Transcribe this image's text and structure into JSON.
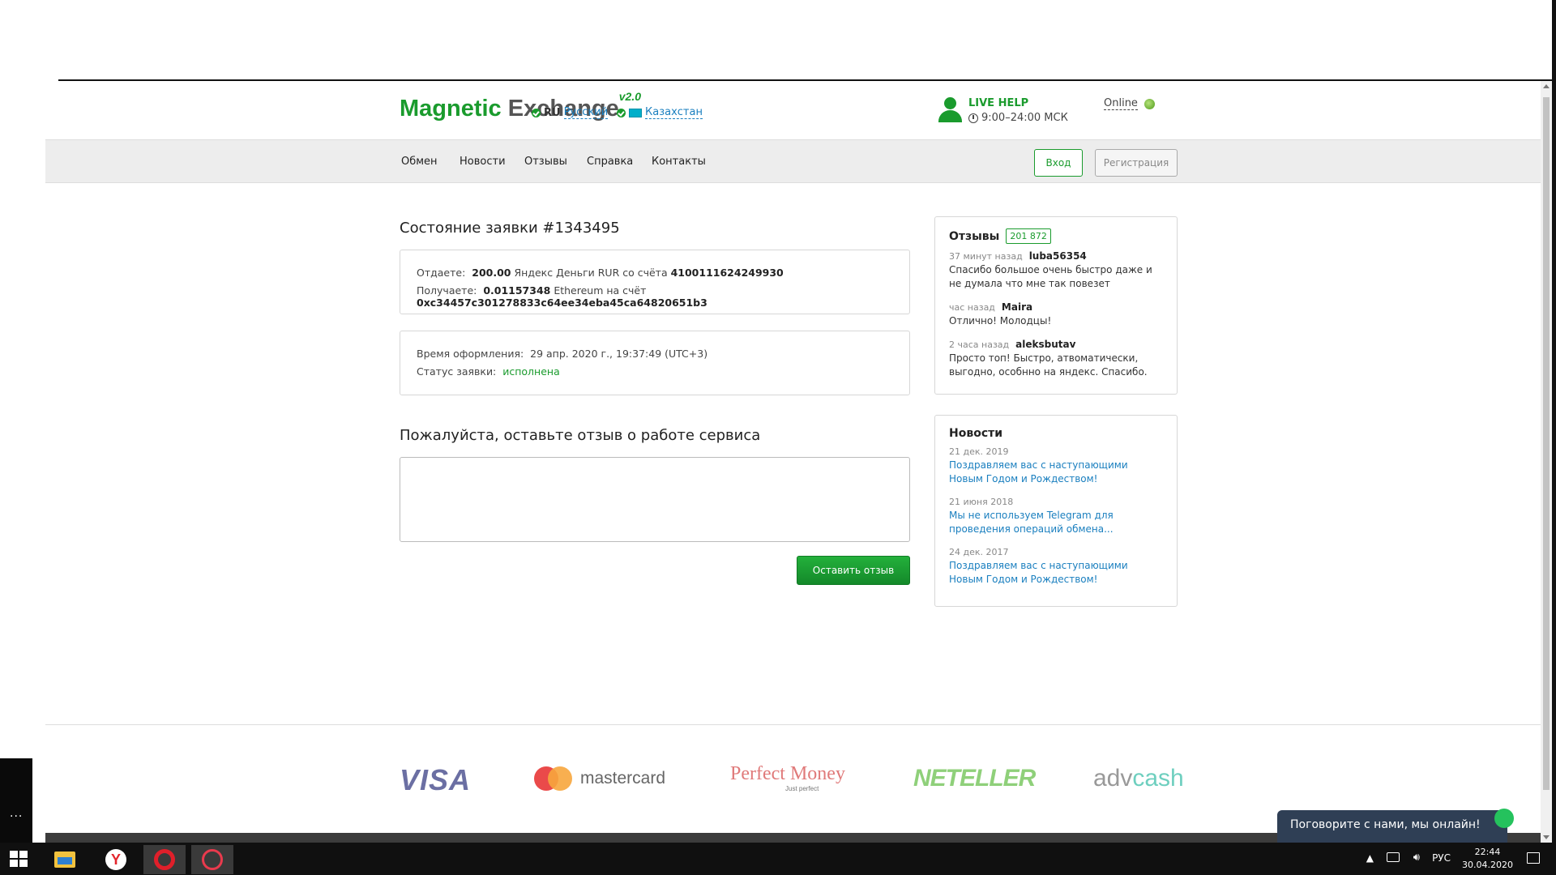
{
  "header": {
    "logo_part1": "Magnetic",
    "logo_part2": "Exchange",
    "logo_version": "v2.0",
    "lang_code": "RU",
    "lang_name": "Русский",
    "country": "Казахстан",
    "live_help": "LIVE HELP",
    "live_help_hours": "9:00–24:00 МСК",
    "online": "Online"
  },
  "nav": {
    "items": [
      "Обмен",
      "Новости",
      "Отзывы",
      "Справка",
      "Контакты"
    ],
    "login": "Вход",
    "register": "Регистрация"
  },
  "order": {
    "title": "Состояние заявки #1343495",
    "give_label": "Отдаете:",
    "give_amount": "200.00",
    "give_currency": "Яндекс Деньги RUR со счёта",
    "give_account": "4100111624249930",
    "get_label": "Получаете:",
    "get_amount": "0.01157348",
    "get_currency": "Ethereum на счёт",
    "get_account": "0xc34457c301278833c64ee34eba45ca64820651b3",
    "time_label": "Время оформления:",
    "time_value": "29 апр. 2020 г., 19:37:49 (UTC+3)",
    "status_label": "Статус заявки:",
    "status_value": "исполнена"
  },
  "feedback": {
    "title": "Пожалуйста, оставьте отзыв о работе сервиса",
    "textarea_value": "",
    "submit": "Оставить отзыв"
  },
  "reviews": {
    "title": "Отзывы",
    "count": "201 872",
    "items": [
      {
        "time": "37 минут назад",
        "user": "luba56354",
        "text": "Спасибо большое очень быстро даже и не думала что мне так повезет"
      },
      {
        "time": "час назад",
        "user": "Maira",
        "text": "Отлично! Молодцы!"
      },
      {
        "time": "2 часа назад",
        "user": "aleksbutav",
        "text": "Просто топ! Быстро, атвоматически, выгодно, особнно на яндекс. Спасибо."
      }
    ]
  },
  "news": {
    "title": "Новости",
    "items": [
      {
        "date": "21 дек. 2019",
        "text": "Поздравляем вас с наступающими Новым Годом и Рождеством!"
      },
      {
        "date": "21 июня 2018",
        "text": "Мы не используем Telegram для проведения операций обмена..."
      },
      {
        "date": "24 дек. 2017",
        "text": "Поздравляем вас с наступающими Новым Годом и Рождеством!"
      }
    ]
  },
  "footer": {
    "visa": "VISA",
    "mastercard": "mastercard",
    "perfect_money": "Perfect Money",
    "perfect_money_sub": "Just perfect",
    "neteller": "NETELLER",
    "advcash_1": "adv",
    "advcash_2": "cash"
  },
  "chat": {
    "label": "Поговорите с нами, мы онлайн!"
  },
  "taskbar": {
    "language": "РУС",
    "time": "22:44",
    "date": "30.04.2020",
    "yandex_letter": "Y",
    "left_panel_dots": "..."
  },
  "colors": {
    "brand_green": "#1a9b2d",
    "link_blue": "#1a7fbf"
  },
  "icons": [
    "windows-start-icon",
    "file-explorer-icon",
    "yandex-browser-icon",
    "opera-icon",
    "opera-gx-icon",
    "person-icon",
    "clock-icon",
    "globe-icon",
    "checkmark-icon",
    "flag-kz-icon"
  ]
}
